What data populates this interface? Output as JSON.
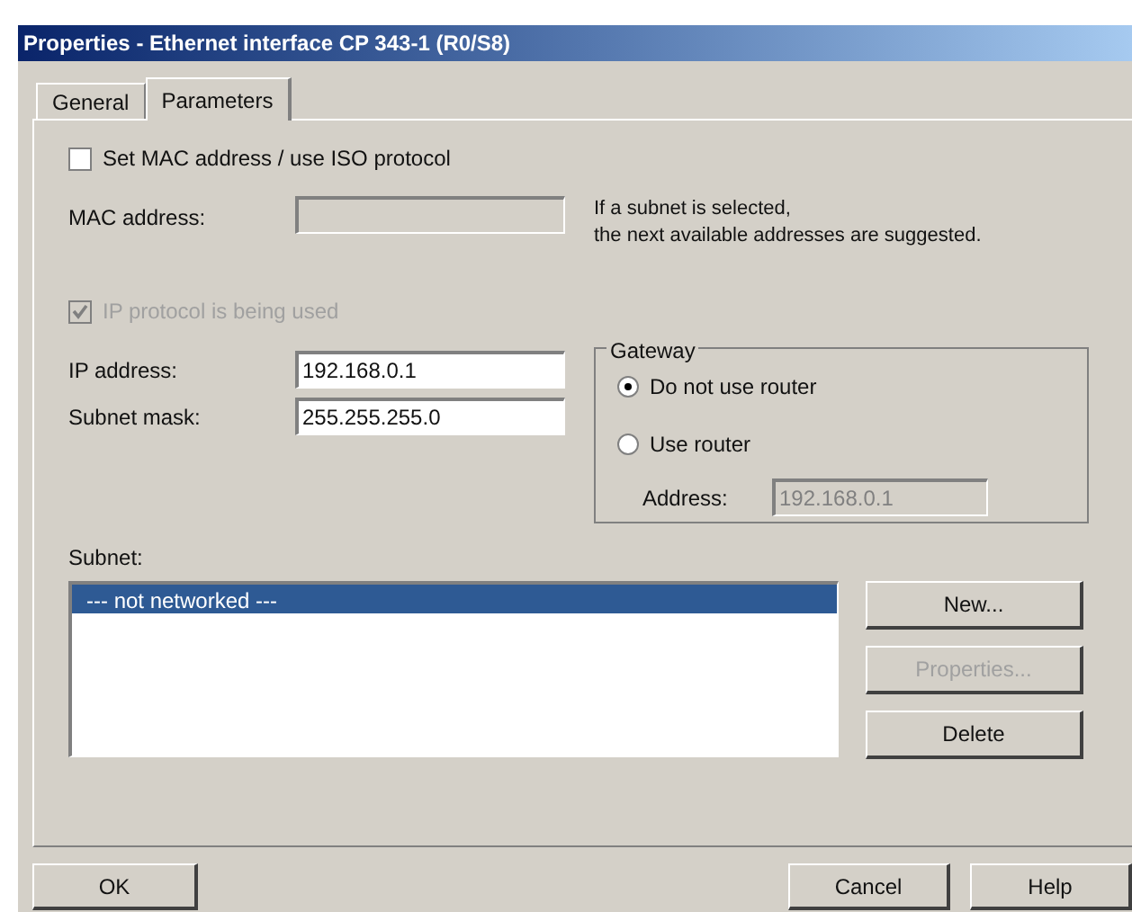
{
  "window": {
    "title": "Properties - Ethernet interface  CP 343-1 (R0/S8)"
  },
  "tabs": [
    {
      "label": "General",
      "selected": false
    },
    {
      "label": "Parameters",
      "selected": true
    }
  ],
  "set_mac": {
    "label": "Set MAC address / use ISO protocol",
    "checked": false,
    "disabled": false
  },
  "mac_address": {
    "label": "MAC address:",
    "disabled": true
  },
  "hint": [
    "If a subnet is selected,",
    "the next available addresses are suggested."
  ],
  "ip_protocol": {
    "label": "IP protocol is being used",
    "checked": true,
    "disabled": true
  },
  "ip_fields": [
    {
      "label": "IP address:",
      "value": "192.168.0.1"
    },
    {
      "label": "Subnet mask:",
      "value": "255.255.255.0"
    }
  ],
  "gateway": {
    "title": "Gateway",
    "options": [
      {
        "label": "Do not use router",
        "selected": true
      },
      {
        "label": "Use router",
        "selected": false
      }
    ],
    "address": {
      "label": "Address:",
      "value": "192.168.0.1",
      "disabled": true
    }
  },
  "subnet": {
    "label": "Subnet:",
    "items": [
      {
        "label": "--- not networked ---",
        "selected": true
      }
    ]
  },
  "side_buttons": [
    {
      "label": "New...",
      "disabled": false
    },
    {
      "label": "Properties...",
      "disabled": true
    },
    {
      "label": "Delete",
      "disabled": false
    }
  ],
  "footer_buttons": [
    {
      "label": "OK",
      "kind": "left"
    },
    {
      "label": "Cancel",
      "kind": "right"
    },
    {
      "label": "Help",
      "kind": "right"
    }
  ]
}
